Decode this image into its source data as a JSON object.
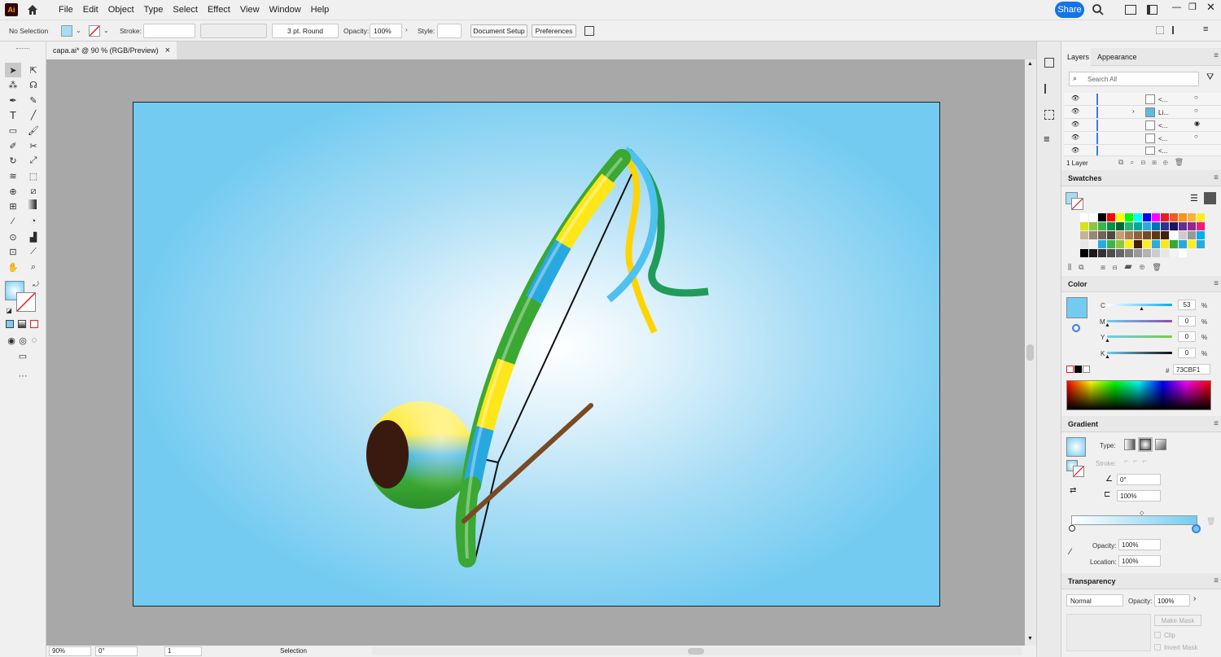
{
  "app": {
    "logo": "Ai"
  },
  "menu": [
    "File",
    "Edit",
    "Object",
    "Type",
    "Select",
    "Effect",
    "View",
    "Window",
    "Help"
  ],
  "header": {
    "share_label": "Share"
  },
  "controlbar": {
    "selection": "No Selection",
    "stroke_label": "Stroke:",
    "brush": "3 pt. Round",
    "opacity_label": "Opacity:",
    "opacity_value": "100%",
    "style_label": "Style:",
    "document_setup": "Document Setup",
    "preferences": "Preferences"
  },
  "document_tab": {
    "title": "capa.ai* @ 90 % (RGB/Preview)",
    "close": "×"
  },
  "status": {
    "zoom": "90%",
    "rotation": "0°",
    "artboard": "1",
    "tool": "Selection"
  },
  "layers_panel": {
    "tabs": [
      "Layers",
      "Appearance"
    ],
    "search_placeholder": "Search All",
    "rows": [
      "<...",
      "Li...",
      "<...",
      "<...",
      "<..."
    ],
    "count": "1 Layer"
  },
  "swatches_panel": {
    "title": "Swatches"
  },
  "color_panel": {
    "title": "Color",
    "channels": [
      {
        "label": "C",
        "value": "53",
        "unit": "%"
      },
      {
        "label": "M",
        "value": "0",
        "unit": "%"
      },
      {
        "label": "Y",
        "value": "0",
        "unit": "%"
      },
      {
        "label": "K",
        "value": "0",
        "unit": "%"
      }
    ],
    "hex_prefix": "#",
    "hex": "73CBF1",
    "fill_color": "#73cbf1"
  },
  "gradient_panel": {
    "title": "Gradient",
    "type_label": "Type:",
    "stroke_label": "Stroke:",
    "angle": "0°",
    "aspect": "100%",
    "opacity_label": "Opacity:",
    "opacity": "100%",
    "location_label": "Location:",
    "location": "100%"
  },
  "transparency_panel": {
    "title": "Transparency",
    "blend_mode": "Normal",
    "opacity_label": "Opacity:",
    "opacity": "100%",
    "make_mask": "Make Mask",
    "clip": "Clip",
    "invert_mask": "Invert Mask"
  },
  "colors": {
    "accent": "#1473e6",
    "canvas_fill": "#73cbf1",
    "pasteboard": "#a8a8a8",
    "yellow": "#ffe619",
    "green": "#3aa833",
    "blue": "#29a8e0",
    "brown": "#7a4a23"
  }
}
